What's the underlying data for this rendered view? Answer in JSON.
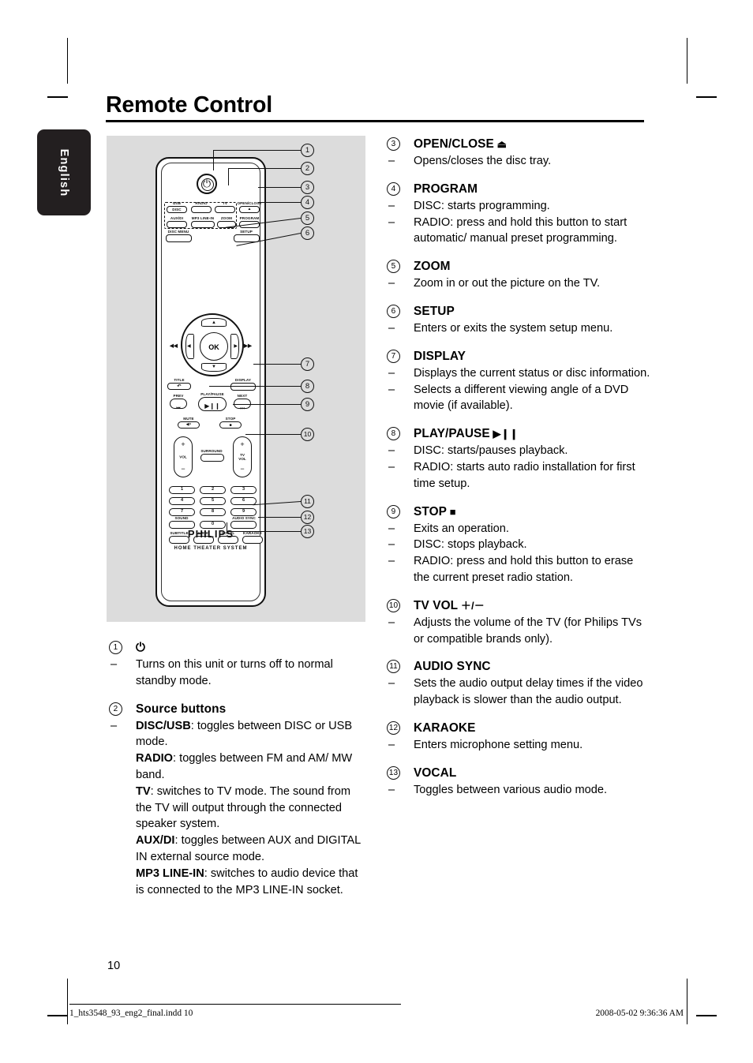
{
  "page": {
    "title": "Remote Control",
    "language_tab": "English",
    "page_number": "10",
    "footer_left": "1_hts3548_93_eng2_final.indd   10",
    "footer_right": "2008-05-02   9:36:36 AM",
    "background_color": "#ffffff",
    "figure_background_color": "#dcdcdc",
    "tab_color": "#231f20"
  },
  "figure": {
    "name": "remote-control-diagram",
    "brand": "PHILIPS",
    "product_line": "HOME THEATER SYSTEM",
    "callouts": [
      "1",
      "2",
      "3",
      "4",
      "5",
      "6",
      "7",
      "8",
      "9",
      "10",
      "11",
      "12",
      "13"
    ],
    "remote_buttons": {
      "power": "⏻",
      "source_group": [
        "USB",
        "DISC",
        "RADIO",
        "TV"
      ],
      "source_group2": [
        "AUX/DI",
        "MP3 LINE-IN"
      ],
      "open_close": "OPEN/CLOSE",
      "open_close_glyph": "▲",
      "zoom": "ZOOM",
      "program": "PROGRAM",
      "disc_menu": "DISC MENU",
      "setup": "SETUP",
      "ok": "OK",
      "rew": "◀◀",
      "ff": "▶▶",
      "title": "TITLE",
      "title_glyph": "↶",
      "display": "DISPLAY",
      "prev": "PREV",
      "prev_glyph": "⏮",
      "play_pause": "PLAY/PAUSE",
      "play_pause_glyph": "▶❙❙",
      "next": "NEXT",
      "next_glyph": "⏭",
      "mute": "MUTE",
      "mute_glyph": "◀×",
      "stop": "STOP",
      "stop_glyph": "■",
      "vol": "VOL",
      "surround": "SURROUND",
      "tv_vol": "TV\nVOL",
      "numbers": [
        "1",
        "2",
        "3",
        "4",
        "5",
        "6",
        "7",
        "8",
        "9",
        "0"
      ],
      "sound": "SOUND",
      "audio_sync": "AUDIO SYNC",
      "subtitle": "SUBTITLE",
      "audio": "AUDIO",
      "vocal": "VOCAL",
      "karaoke": "KARAOKE",
      "plus": "+",
      "minus": "−"
    }
  },
  "left_column": [
    {
      "num": "1",
      "head": "⏻",
      "head_is_symbol": true,
      "lines": [
        {
          "type": "dash",
          "text": "Turns on this unit or turns off to normal standby mode."
        }
      ]
    },
    {
      "num": "2",
      "head": "Source buttons",
      "lines": [
        {
          "type": "dash",
          "bold": "DISC/USB",
          "text": ": toggles between DISC or USB mode."
        },
        {
          "type": "cont",
          "bold": "RADIO",
          "text": ": toggles between FM and AM/ MW band."
        },
        {
          "type": "cont",
          "bold": "TV",
          "text": ": switches to TV mode. The sound from the TV will output through the connected speaker system."
        },
        {
          "type": "cont",
          "bold": "AUX/DI",
          "text": ": toggles between AUX and DIGITAL IN external source mode."
        },
        {
          "type": "cont",
          "bold": "MP3 LINE-IN",
          "text": ": switches to audio device that is connected to the MP3 LINE-IN socket."
        }
      ]
    }
  ],
  "right_column": [
    {
      "num": "3",
      "head": "OPEN/CLOSE",
      "head_suffix": "⏏",
      "lines": [
        {
          "type": "dash",
          "text": "Opens/closes the disc tray."
        }
      ]
    },
    {
      "num": "4",
      "head": "PROGRAM",
      "lines": [
        {
          "type": "dash",
          "text": "DISC: starts programming."
        },
        {
          "type": "dash",
          "text": "RADIO: press and hold this button to start automatic/ manual preset programming."
        }
      ]
    },
    {
      "num": "5",
      "head": "ZOOM",
      "lines": [
        {
          "type": "dash",
          "text": "Zoom in or out the picture on the TV."
        }
      ]
    },
    {
      "num": "6",
      "head": "SETUP",
      "lines": [
        {
          "type": "dash",
          "text": "Enters or exits the system setup menu."
        }
      ]
    },
    {
      "num": "7",
      "head": "DISPLAY",
      "lines": [
        {
          "type": "dash",
          "text": "Displays the current status or disc information."
        },
        {
          "type": "dash",
          "text": "Selects a different viewing angle of a DVD movie (if available)."
        }
      ]
    },
    {
      "num": "8",
      "head": "PLAY/PAUSE",
      "head_suffix": "▶❙❙",
      "lines": [
        {
          "type": "dash",
          "text": "DISC: starts/pauses playback."
        },
        {
          "type": "dash",
          "text": "RADIO: starts auto radio installation for first time setup."
        }
      ]
    },
    {
      "num": "9",
      "head": "STOP",
      "head_suffix": "■",
      "lines": [
        {
          "type": "dash",
          "text": "Exits an operation."
        },
        {
          "type": "dash",
          "text": "DISC: stops playback."
        },
        {
          "type": "dash",
          "text": "RADIO: press and hold this button to erase the current preset radio station."
        }
      ]
    },
    {
      "num": "10",
      "head": "TV VOL",
      "head_suffix": "＋/－",
      "lines": [
        {
          "type": "dash",
          "text": "Adjusts the volume of the TV (for Philips TVs or compatible brands only)."
        }
      ]
    },
    {
      "num": "11",
      "head": "AUDIO SYNC",
      "lines": [
        {
          "type": "dash",
          "text": "Sets the audio output delay times if the video playback is slower than the audio output."
        }
      ]
    },
    {
      "num": "12",
      "head": "KARAOKE",
      "lines": [
        {
          "type": "dash",
          "text": "Enters microphone setting menu."
        }
      ]
    },
    {
      "num": "13",
      "head": "VOCAL",
      "lines": [
        {
          "type": "dash",
          "text": "Toggles between various audio mode."
        }
      ]
    }
  ]
}
